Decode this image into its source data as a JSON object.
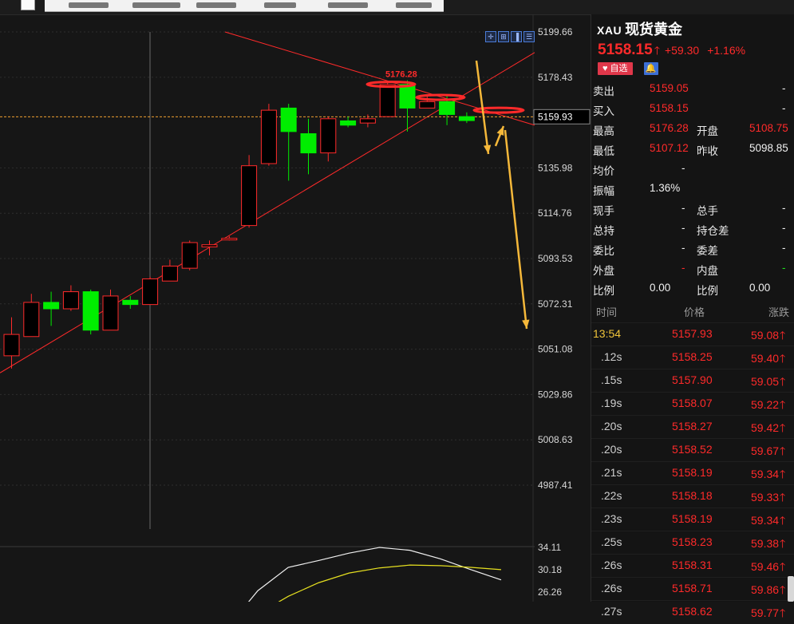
{
  "symbol": {
    "code": "XAU",
    "name": "现货黄金"
  },
  "quote": {
    "price": "5158.15",
    "change": "+59.30",
    "change_pct": "+1.16%",
    "fav_label": "自选",
    "rows": [
      {
        "l1": "卖出",
        "v1": "5159.05",
        "v1c": "red",
        "l2": "",
        "v2": "-",
        "v2c": "wht"
      },
      {
        "l1": "买入",
        "v1": "5158.15",
        "v1c": "red",
        "l2": "",
        "v2": "-",
        "v2c": "wht"
      },
      {
        "l1": "最高",
        "v1": "5176.28",
        "v1c": "red",
        "l2": "开盘",
        "v2": "5108.75",
        "v2c": "red"
      },
      {
        "l1": "最低",
        "v1": "5107.12",
        "v1c": "red",
        "l2": "昨收",
        "v2": "5098.85",
        "v2c": "wht"
      },
      {
        "l1": "均价",
        "v1": "-",
        "v1c": "wht",
        "l2": "",
        "v2": "",
        "v2c": "wht"
      },
      {
        "l1": "振幅",
        "v1": "1.36%",
        "v1c": "wht",
        "l2": "",
        "v2": "",
        "v2c": "wht"
      },
      {
        "l1": "现手",
        "v1": "-",
        "v1c": "wht",
        "l2": "总手",
        "v2": "-",
        "v2c": "wht"
      },
      {
        "l1": "总持",
        "v1": "-",
        "v1c": "wht",
        "l2": "持仓差",
        "v2": "-",
        "v2c": "wht"
      },
      {
        "l1": "委比",
        "v1": "-",
        "v1c": "wht",
        "l2": "委差",
        "v2": "-",
        "v2c": "wht"
      },
      {
        "l1": "外盘",
        "v1": "-",
        "v1c": "red",
        "l2": "内盘",
        "v2": "-",
        "v2c": "grn"
      },
      {
        "l1": "比例",
        "v1": "0.00",
        "v1c": "wht",
        "l2": "比例",
        "v2": "0.00",
        "v2c": "wht"
      }
    ]
  },
  "ticks_header": {
    "time": "时间",
    "price": "价格",
    "change": "涨跌"
  },
  "ticks": [
    {
      "time": "13:54",
      "price": "5157.93",
      "change": "59.08"
    },
    {
      "time": ".12s",
      "price": "5158.25",
      "change": "59.40"
    },
    {
      "time": ".15s",
      "price": "5157.90",
      "change": "59.05"
    },
    {
      "time": ".19s",
      "price": "5158.07",
      "change": "59.22"
    },
    {
      "time": ".20s",
      "price": "5158.27",
      "change": "59.42"
    },
    {
      "time": ".20s",
      "price": "5158.52",
      "change": "59.67"
    },
    {
      "time": ".21s",
      "price": "5158.19",
      "change": "59.34"
    },
    {
      "time": ".22s",
      "price": "5158.18",
      "change": "59.33"
    },
    {
      "time": ".23s",
      "price": "5158.19",
      "change": "59.34"
    },
    {
      "time": ".25s",
      "price": "5158.23",
      "change": "59.38"
    },
    {
      "time": ".26s",
      "price": "5158.31",
      "change": "59.46"
    },
    {
      "time": ".26s",
      "price": "5158.71",
      "change": "59.86"
    },
    {
      "time": ".27s",
      "price": "5158.62",
      "change": "59.77"
    }
  ],
  "chart": {
    "price_ticks": [
      "5199.66",
      "5178.43",
      "5135.98",
      "5114.76",
      "5093.53",
      "5072.31",
      "5051.08",
      "5029.86",
      "5008.63",
      "4987.41"
    ],
    "price_tick_values": [
      5199.66,
      5178.43,
      5135.98,
      5114.76,
      5093.53,
      5072.31,
      5051.08,
      5029.86,
      5008.63,
      4987.41
    ],
    "current_price_label": "5159.93",
    "current_price_value": 5159.93,
    "high_annotation": "5176.28",
    "high_annotation_value": 5176.28,
    "indicator_ticks": [
      "34.11",
      "30.18",
      "26.26"
    ],
    "indicator_tick_values": [
      34.11,
      30.18,
      26.26
    ],
    "colors": {
      "up": "#ff2a2a",
      "down": "#00ee00",
      "trend": "#ff2a2a",
      "arrow": "#f5b83a",
      "ind_fast": "#f0f0f0",
      "ind_slow": "#e6e020"
    }
  },
  "chart_data": {
    "type": "candlestick",
    "y_axis_ticks": [
      5199.66,
      5178.43,
      5135.98,
      5114.76,
      5093.53,
      5072.31,
      5051.08,
      5029.86,
      5008.63,
      4987.41
    ],
    "candles": [
      {
        "o": 5058.0,
        "h": 5066.0,
        "l": 5042.0,
        "c": 5048.0,
        "dir": "up"
      },
      {
        "o": 5057.0,
        "h": 5077.0,
        "l": 5057.0,
        "c": 5073.0,
        "dir": "up"
      },
      {
        "o": 5073.0,
        "h": 5078.0,
        "l": 5062.0,
        "c": 5070.0,
        "dir": "down"
      },
      {
        "o": 5070.0,
        "h": 5081.0,
        "l": 5069.0,
        "c": 5078.0,
        "dir": "up"
      },
      {
        "o": 5078.0,
        "h": 5079.0,
        "l": 5058.0,
        "c": 5060.0,
        "dir": "down"
      },
      {
        "o": 5060.0,
        "h": 5079.0,
        "l": 5060.0,
        "c": 5076.0,
        "dir": "up"
      },
      {
        "o": 5074.0,
        "h": 5076.0,
        "l": 5070.0,
        "c": 5072.0,
        "dir": "down"
      },
      {
        "o": 5072.0,
        "h": 5085.0,
        "l": 5072.0,
        "c": 5084.0,
        "dir": "up"
      },
      {
        "o": 5083.0,
        "h": 5093.0,
        "l": 5083.0,
        "c": 5090.0,
        "dir": "up"
      },
      {
        "o": 5089.0,
        "h": 5102.0,
        "l": 5088.0,
        "c": 5101.0,
        "dir": "up"
      },
      {
        "o": 5099.0,
        "h": 5102.0,
        "l": 5095.0,
        "c": 5100.0,
        "dir": "up"
      },
      {
        "o": 5103.0,
        "h": 5104.0,
        "l": 5102.0,
        "c": 5103.0,
        "dir": "up"
      },
      {
        "o": 5109.0,
        "h": 5142.0,
        "l": 5108.0,
        "c": 5137.0,
        "dir": "up"
      },
      {
        "o": 5138.0,
        "h": 5166.0,
        "l": 5137.0,
        "c": 5163.0,
        "dir": "up"
      },
      {
        "o": 5164.0,
        "h": 5166.0,
        "l": 5130.0,
        "c": 5153.0,
        "dir": "down"
      },
      {
        "o": 5152.0,
        "h": 5159.0,
        "l": 5133.0,
        "c": 5143.0,
        "dir": "down"
      },
      {
        "o": 5143.0,
        "h": 5160.0,
        "l": 5139.0,
        "c": 5159.0,
        "dir": "up"
      },
      {
        "o": 5158.0,
        "h": 5160.0,
        "l": 5155.0,
        "c": 5156.0,
        "dir": "down"
      },
      {
        "o": 5157.0,
        "h": 5161.0,
        "l": 5155.0,
        "c": 5159.0,
        "dir": "up"
      },
      {
        "o": 5160.0,
        "h": 5176.28,
        "l": 5160.0,
        "c": 5175.0,
        "dir": "up"
      },
      {
        "o": 5175.0,
        "h": 5177.0,
        "l": 5153.0,
        "c": 5164.0,
        "dir": "down"
      },
      {
        "o": 5164.0,
        "h": 5170.0,
        "l": 5164.0,
        "c": 5167.0,
        "dir": "up"
      },
      {
        "o": 5167.0,
        "h": 5170.0,
        "l": 5156.0,
        "c": 5161.0,
        "dir": "down"
      },
      {
        "o": 5160.0,
        "h": 5162.0,
        "l": 5157.0,
        "c": 5158.15,
        "dir": "down"
      }
    ],
    "indicator_fast": [
      20.0,
      26.5,
      30.6,
      31.8,
      33.1,
      34.1,
      33.6,
      32.1,
      30.2,
      28.4
    ],
    "indicator_slow": [
      19.0,
      22.4,
      25.5,
      27.9,
      29.6,
      30.5,
      31.0,
      30.9,
      30.6,
      30.2
    ]
  }
}
